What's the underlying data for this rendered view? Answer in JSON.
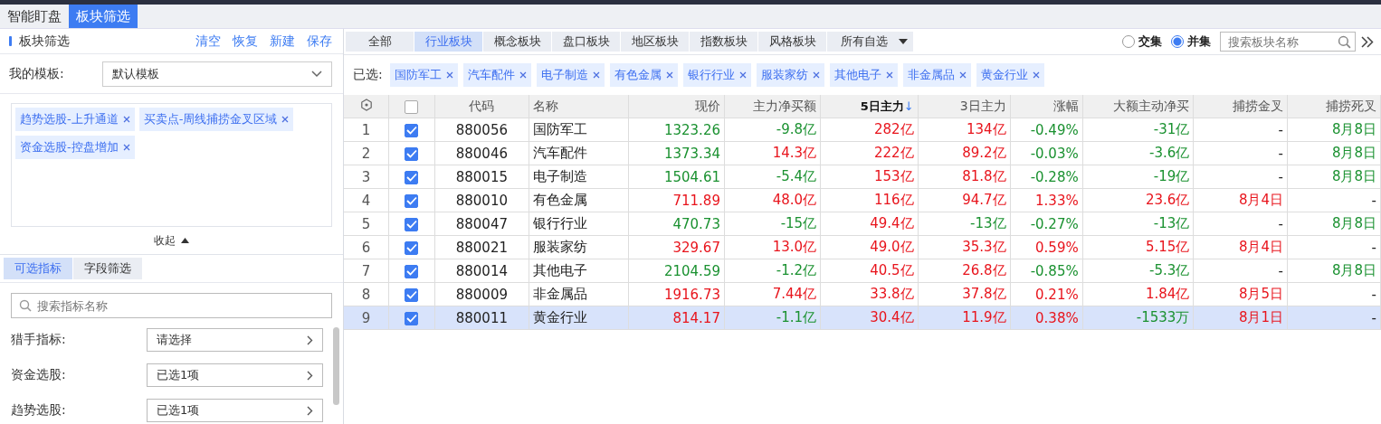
{
  "top_tabs": [
    {
      "label": "智能盯盘",
      "selected": false
    },
    {
      "label": "板块筛选",
      "selected": true
    }
  ],
  "left": {
    "title": "板块筛选",
    "actions": [
      "清空",
      "恢复",
      "新建",
      "保存"
    ],
    "template": {
      "label": "我的模板:",
      "value": "默认模板"
    },
    "tags": [
      "趋势选股-上升通道",
      "买卖点-周线捕捞金叉区域",
      "资金选股-控盘增加"
    ],
    "collapse": "收起",
    "sub_tabs": [
      {
        "label": "可选指标",
        "selected": true
      },
      {
        "label": "字段筛选",
        "selected": false
      }
    ],
    "search": {
      "placeholder": "搜索指标名称"
    },
    "filters": [
      {
        "label": "猎手指标:",
        "value": "请选择"
      },
      {
        "label": "资金选股:",
        "value": "已选1项"
      },
      {
        "label": "趋势选股:",
        "value": "已选1项"
      }
    ]
  },
  "categories": [
    {
      "label": "全部",
      "selected": false
    },
    {
      "label": "行业板块",
      "selected": true
    },
    {
      "label": "概念板块",
      "selected": false
    },
    {
      "label": "盘口板块",
      "selected": false
    },
    {
      "label": "地区板块",
      "selected": false
    },
    {
      "label": "指数板块",
      "selected": false
    },
    {
      "label": "风格板块",
      "selected": false
    },
    {
      "label": "所有自选",
      "selected": false,
      "kind": "dropdown"
    }
  ],
  "modes": [
    {
      "label": "交集",
      "selected": false
    },
    {
      "label": "并集",
      "selected": true
    }
  ],
  "board_search": {
    "placeholder": "搜索板块名称"
  },
  "chosen": {
    "label": "已选:",
    "items": [
      "国防军工",
      "汽车配件",
      "电子制造",
      "有色金属",
      "银行行业",
      "服装家纺",
      "其他电子",
      "非金属品",
      "黄金行业"
    ]
  },
  "table": {
    "all_checked": false,
    "columns": [
      {
        "label": "代码",
        "sorted": false
      },
      {
        "label": "名称",
        "sorted": false
      },
      {
        "label": "现价",
        "sorted": false
      },
      {
        "label": "主力净买额",
        "sorted": false
      },
      {
        "label": "5日主力",
        "sorted": true,
        "sort_arrow": "↓"
      },
      {
        "label": "3日主力",
        "sorted": false
      },
      {
        "label": "涨幅",
        "sorted": false
      },
      {
        "label": "大额主动净买",
        "sorted": false
      },
      {
        "label": "捕捞金叉",
        "sorted": false
      },
      {
        "label": "捕捞死叉",
        "sorted": false
      }
    ],
    "rows": [
      {
        "index": "1",
        "checked": true,
        "selected": false,
        "cells": [
          {
            "text": "880056",
            "kind": "flat"
          },
          {
            "text": "国防军工",
            "kind": "flat"
          },
          {
            "text": "1323.26",
            "kind": "down"
          },
          {
            "text": "-9.8亿",
            "kind": "down"
          },
          {
            "text": "282亿",
            "kind": "up"
          },
          {
            "text": "134亿",
            "kind": "up"
          },
          {
            "text": "-0.49%",
            "kind": "down"
          },
          {
            "text": "-31亿",
            "kind": "down"
          },
          {
            "text": "-",
            "kind": "flat"
          },
          {
            "text": "8月8日",
            "kind": "down"
          }
        ]
      },
      {
        "index": "2",
        "checked": true,
        "selected": false,
        "cells": [
          {
            "text": "880046",
            "kind": "flat"
          },
          {
            "text": "汽车配件",
            "kind": "flat"
          },
          {
            "text": "1373.34",
            "kind": "down"
          },
          {
            "text": "14.3亿",
            "kind": "up"
          },
          {
            "text": "222亿",
            "kind": "up"
          },
          {
            "text": "89.2亿",
            "kind": "up"
          },
          {
            "text": "-0.03%",
            "kind": "down"
          },
          {
            "text": "-3.6亿",
            "kind": "down"
          },
          {
            "text": "-",
            "kind": "flat"
          },
          {
            "text": "8月8日",
            "kind": "down"
          }
        ]
      },
      {
        "index": "3",
        "checked": true,
        "selected": false,
        "cells": [
          {
            "text": "880015",
            "kind": "flat"
          },
          {
            "text": "电子制造",
            "kind": "flat"
          },
          {
            "text": "1504.61",
            "kind": "down"
          },
          {
            "text": "-5.4亿",
            "kind": "down"
          },
          {
            "text": "153亿",
            "kind": "up"
          },
          {
            "text": "81.8亿",
            "kind": "up"
          },
          {
            "text": "-0.28%",
            "kind": "down"
          },
          {
            "text": "-19亿",
            "kind": "down"
          },
          {
            "text": "-",
            "kind": "flat"
          },
          {
            "text": "8月8日",
            "kind": "down"
          }
        ]
      },
      {
        "index": "4",
        "checked": true,
        "selected": false,
        "cells": [
          {
            "text": "880010",
            "kind": "flat"
          },
          {
            "text": "有色金属",
            "kind": "flat"
          },
          {
            "text": "711.89",
            "kind": "up"
          },
          {
            "text": "48.0亿",
            "kind": "up"
          },
          {
            "text": "116亿",
            "kind": "up"
          },
          {
            "text": "94.7亿",
            "kind": "up"
          },
          {
            "text": "1.33%",
            "kind": "up"
          },
          {
            "text": "23.6亿",
            "kind": "up"
          },
          {
            "text": "8月4日",
            "kind": "up"
          },
          {
            "text": "-",
            "kind": "flat"
          }
        ]
      },
      {
        "index": "5",
        "checked": true,
        "selected": false,
        "cells": [
          {
            "text": "880047",
            "kind": "flat"
          },
          {
            "text": "银行行业",
            "kind": "flat"
          },
          {
            "text": "470.73",
            "kind": "down"
          },
          {
            "text": "-15亿",
            "kind": "down"
          },
          {
            "text": "49.4亿",
            "kind": "up"
          },
          {
            "text": "-13亿",
            "kind": "down"
          },
          {
            "text": "-0.27%",
            "kind": "down"
          },
          {
            "text": "-13亿",
            "kind": "down"
          },
          {
            "text": "-",
            "kind": "flat"
          },
          {
            "text": "8月8日",
            "kind": "down"
          }
        ]
      },
      {
        "index": "6",
        "checked": true,
        "selected": false,
        "cells": [
          {
            "text": "880021",
            "kind": "flat"
          },
          {
            "text": "服装家纺",
            "kind": "flat"
          },
          {
            "text": "329.67",
            "kind": "up"
          },
          {
            "text": "13.0亿",
            "kind": "up"
          },
          {
            "text": "49.0亿",
            "kind": "up"
          },
          {
            "text": "35.3亿",
            "kind": "up"
          },
          {
            "text": "0.59%",
            "kind": "up"
          },
          {
            "text": "5.15亿",
            "kind": "up"
          },
          {
            "text": "8月4日",
            "kind": "up"
          },
          {
            "text": "-",
            "kind": "flat"
          }
        ]
      },
      {
        "index": "7",
        "checked": true,
        "selected": false,
        "cells": [
          {
            "text": "880014",
            "kind": "flat"
          },
          {
            "text": "其他电子",
            "kind": "flat"
          },
          {
            "text": "2104.59",
            "kind": "down"
          },
          {
            "text": "-1.2亿",
            "kind": "down"
          },
          {
            "text": "40.5亿",
            "kind": "up"
          },
          {
            "text": "26.8亿",
            "kind": "up"
          },
          {
            "text": "-0.85%",
            "kind": "down"
          },
          {
            "text": "-5.3亿",
            "kind": "down"
          },
          {
            "text": "-",
            "kind": "flat"
          },
          {
            "text": "8月8日",
            "kind": "down"
          }
        ]
      },
      {
        "index": "8",
        "checked": true,
        "selected": false,
        "cells": [
          {
            "text": "880009",
            "kind": "flat"
          },
          {
            "text": "非金属品",
            "kind": "flat"
          },
          {
            "text": "1916.73",
            "kind": "up"
          },
          {
            "text": "7.44亿",
            "kind": "up"
          },
          {
            "text": "33.8亿",
            "kind": "up"
          },
          {
            "text": "37.8亿",
            "kind": "up"
          },
          {
            "text": "0.21%",
            "kind": "up"
          },
          {
            "text": "1.84亿",
            "kind": "up"
          },
          {
            "text": "8月5日",
            "kind": "up"
          },
          {
            "text": "-",
            "kind": "flat"
          }
        ]
      },
      {
        "index": "9",
        "checked": true,
        "selected": true,
        "cells": [
          {
            "text": "880011",
            "kind": "flat"
          },
          {
            "text": "黄金行业",
            "kind": "flat"
          },
          {
            "text": "814.17",
            "kind": "up"
          },
          {
            "text": "-1.1亿",
            "kind": "down"
          },
          {
            "text": "30.4亿",
            "kind": "up"
          },
          {
            "text": "11.9亿",
            "kind": "up"
          },
          {
            "text": "0.38%",
            "kind": "up"
          },
          {
            "text": "-1533万",
            "kind": "down"
          },
          {
            "text": "8月1日",
            "kind": "up"
          },
          {
            "text": "-",
            "kind": "flat"
          }
        ]
      }
    ]
  }
}
